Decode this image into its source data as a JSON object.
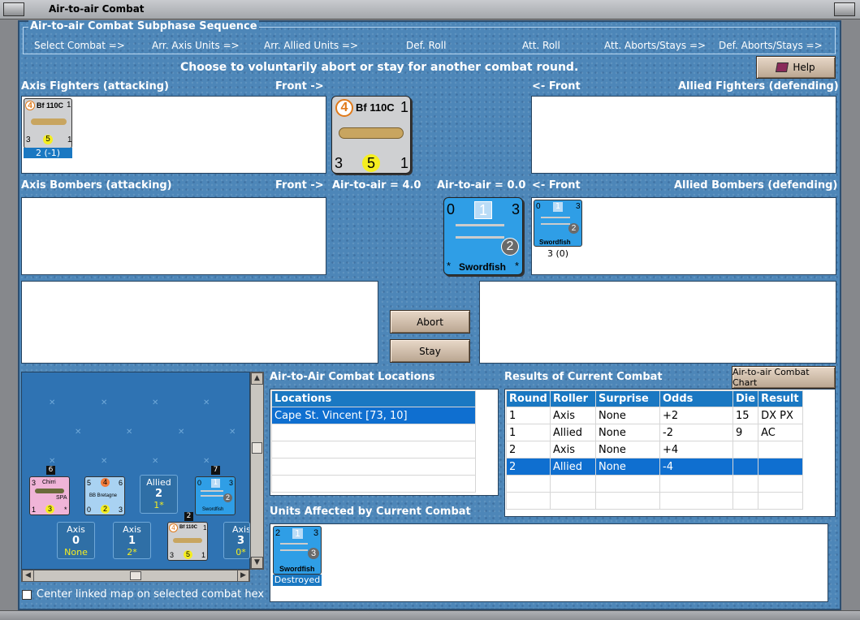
{
  "window": {
    "title": "Air-to-air Combat"
  },
  "sequence": {
    "title": "Air-to-air Combat Subphase Sequence",
    "steps": [
      "Select Combat =>",
      "Arr. Axis Units =>",
      "Arr. Allied Units =>",
      "Def. Roll",
      "Att. Roll",
      "Att. Aborts/Stays =>",
      "Def. Aborts/Stays =>"
    ]
  },
  "instruction": "Choose to voluntarily abort or stay for another combat round.",
  "help_label": "Help",
  "sections": {
    "axis_fighters": "Axis Fighters (attacking)",
    "axis_fighters_front": "Front ->",
    "allied_fighters_front": "<- Front",
    "allied_fighters": "Allied Fighters (defending)",
    "axis_bombers": "Axis Bombers (attacking)",
    "axis_bombers_front": "Front ->",
    "axis_air_to_air": "Air-to-air = 4.0",
    "allied_air_to_air": "Air-to-air = 0.0",
    "allied_bombers_front": "<- Front",
    "allied_bombers": "Allied Bombers (defending)"
  },
  "axis_fighter_unit": {
    "attack": "4",
    "name": "Bf 110C",
    "range": "1",
    "left": "3",
    "center": "5",
    "right": "1",
    "status": "2 (-1)"
  },
  "big_axis": {
    "attack": "4",
    "name": "Bf 110C",
    "range": "1",
    "left": "3",
    "center": "5",
    "right": "1"
  },
  "big_allied": {
    "left": "0",
    "top": "1",
    "right": "3",
    "circle": "2",
    "name": "Swordfish",
    "star_l": "*",
    "star_r": "*"
  },
  "allied_bomber_unit": {
    "left": "0",
    "top": "1",
    "right": "3",
    "circle": "2",
    "name": "Swordfish",
    "status": "3 (0)"
  },
  "buttons": {
    "abort": "Abort",
    "stay": "Stay",
    "chart": "Air-to-air Combat Chart"
  },
  "map": {
    "chirri": {
      "stack": "6",
      "left": "3",
      "name": "Chirri",
      "sub": "SPA",
      "bl": "1",
      "bc": "3",
      "br": "*"
    },
    "bretagne": {
      "left": "5",
      "c1": "4",
      "right": "6",
      "name": "BB Bretagne",
      "bl": "0",
      "bc": "2",
      "br": "3"
    },
    "allied_box": {
      "side": "Allied",
      "num": "2",
      "sub": "1*"
    },
    "swordfish": {
      "stack": "7",
      "left": "0",
      "top": "1",
      "right": "3",
      "circle": "2",
      "name": "Swordfish"
    },
    "axis_box1": {
      "side": "Axis",
      "num": "0",
      "sub": "None"
    },
    "axis_box2": {
      "side": "Axis",
      "num": "1",
      "sub": "2*"
    },
    "bf110": {
      "stack": "2",
      "attack": "4",
      "name": "Bf 110C",
      "range": "1",
      "bl": "3",
      "bc": "5",
      "br": "1"
    },
    "axis_box3": {
      "side": "Axis",
      "num": "3",
      "sub": "0*"
    }
  },
  "center_map_label": "Center linked map on selected combat hex",
  "locations": {
    "title": "Air-to-Air Combat Locations",
    "header": "Locations",
    "rows": [
      "Cape St. Vincent [73, 10]"
    ]
  },
  "results": {
    "title": "Results of Current Combat",
    "headers": [
      "Round",
      "Roller",
      "Surprise",
      "Odds",
      "Die",
      "Result"
    ],
    "rows": [
      [
        "1",
        "Axis",
        "None",
        "+2",
        "15",
        "DX PX"
      ],
      [
        "1",
        "Allied",
        "None",
        "-2",
        "9",
        "AC"
      ],
      [
        "2",
        "Axis",
        "None",
        "+4",
        "",
        ""
      ],
      [
        "2",
        "Allied",
        "None",
        "-4",
        "",
        ""
      ]
    ]
  },
  "affected": {
    "title": "Units Affected by Current Combat",
    "unit": {
      "left": "2",
      "top": "1",
      "right": "3",
      "circle": "3",
      "name": "Swordfish",
      "status": "Destroyed"
    }
  }
}
